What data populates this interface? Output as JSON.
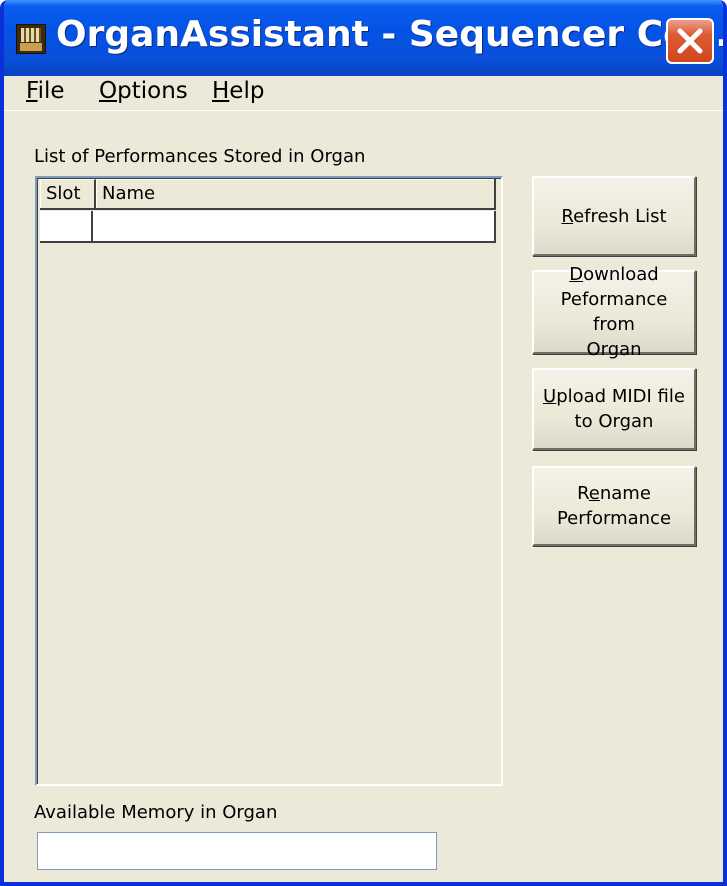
{
  "window": {
    "title": "OrganAssistant - Sequencer Co...",
    "colors": {
      "titlebar": "#0453e6",
      "face": "#ece9d8",
      "close": "#de5b34"
    }
  },
  "menu": {
    "file": {
      "mnemonic": "F",
      "rest": "ile"
    },
    "options": {
      "mnemonic": "O",
      "rest": "ptions"
    },
    "help": {
      "mnemonic": "H",
      "rest": "elp"
    }
  },
  "list": {
    "label": "List of Performances Stored in Organ",
    "columns": {
      "slot": "Slot",
      "name": "Name"
    },
    "rows": [
      {
        "slot": "",
        "name": ""
      }
    ]
  },
  "buttons": {
    "refresh": {
      "mnemonic": "R",
      "rest": "efresh List"
    },
    "download": {
      "mnemonic": "D",
      "rest": "ownload\nPeformance from\nOrgan"
    },
    "upload": {
      "mnemonic": "U",
      "rest": "pload MIDI file\nto Organ"
    },
    "rename": {
      "pre": "R",
      "mnemonic": "e",
      "rest": "name\nPerformance"
    }
  },
  "memory": {
    "label": "Available Memory in Organ",
    "value": ""
  },
  "icons": {
    "app": "organ-icon",
    "close": "close-icon"
  }
}
